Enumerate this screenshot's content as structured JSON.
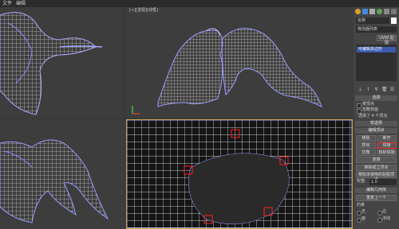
{
  "menubar": {
    "items": [
      "文件",
      "编辑"
    ]
  },
  "viewports": {
    "top_right_label": "[+][透视][线框]"
  },
  "panel": {
    "object_name": "名称",
    "color_hex": "#ffffff",
    "modifier_list": "修改器列表",
    "uvw_map": "UVW 贴图",
    "stack_item": "可编辑多边形",
    "rollout_select": "选择",
    "by_vertex": "按顶点",
    "ignore_backfacing": "忽略背面",
    "selected_count": "选择了 4 个顶点",
    "rollout_soft": "软选择",
    "rollout_edit_vertex": "编辑顶点",
    "remove": "移除",
    "break": "断开",
    "extrude": "挤出",
    "weld": "焊接",
    "chamfer": "切角",
    "target_weld": "目标焊接",
    "connect": "连接",
    "remove_isolated": "移除孤立顶点",
    "remove_unused_map": "移除未使用的贴图顶点",
    "weight_label": "权重:",
    "weight_value": "1.0",
    "rollout_edit_geometry": "编辑几何体",
    "repeat_last": "重复上一个",
    "constraints": "约束",
    "none": "无",
    "edge": "边",
    "face": "面",
    "normal": "法线"
  }
}
